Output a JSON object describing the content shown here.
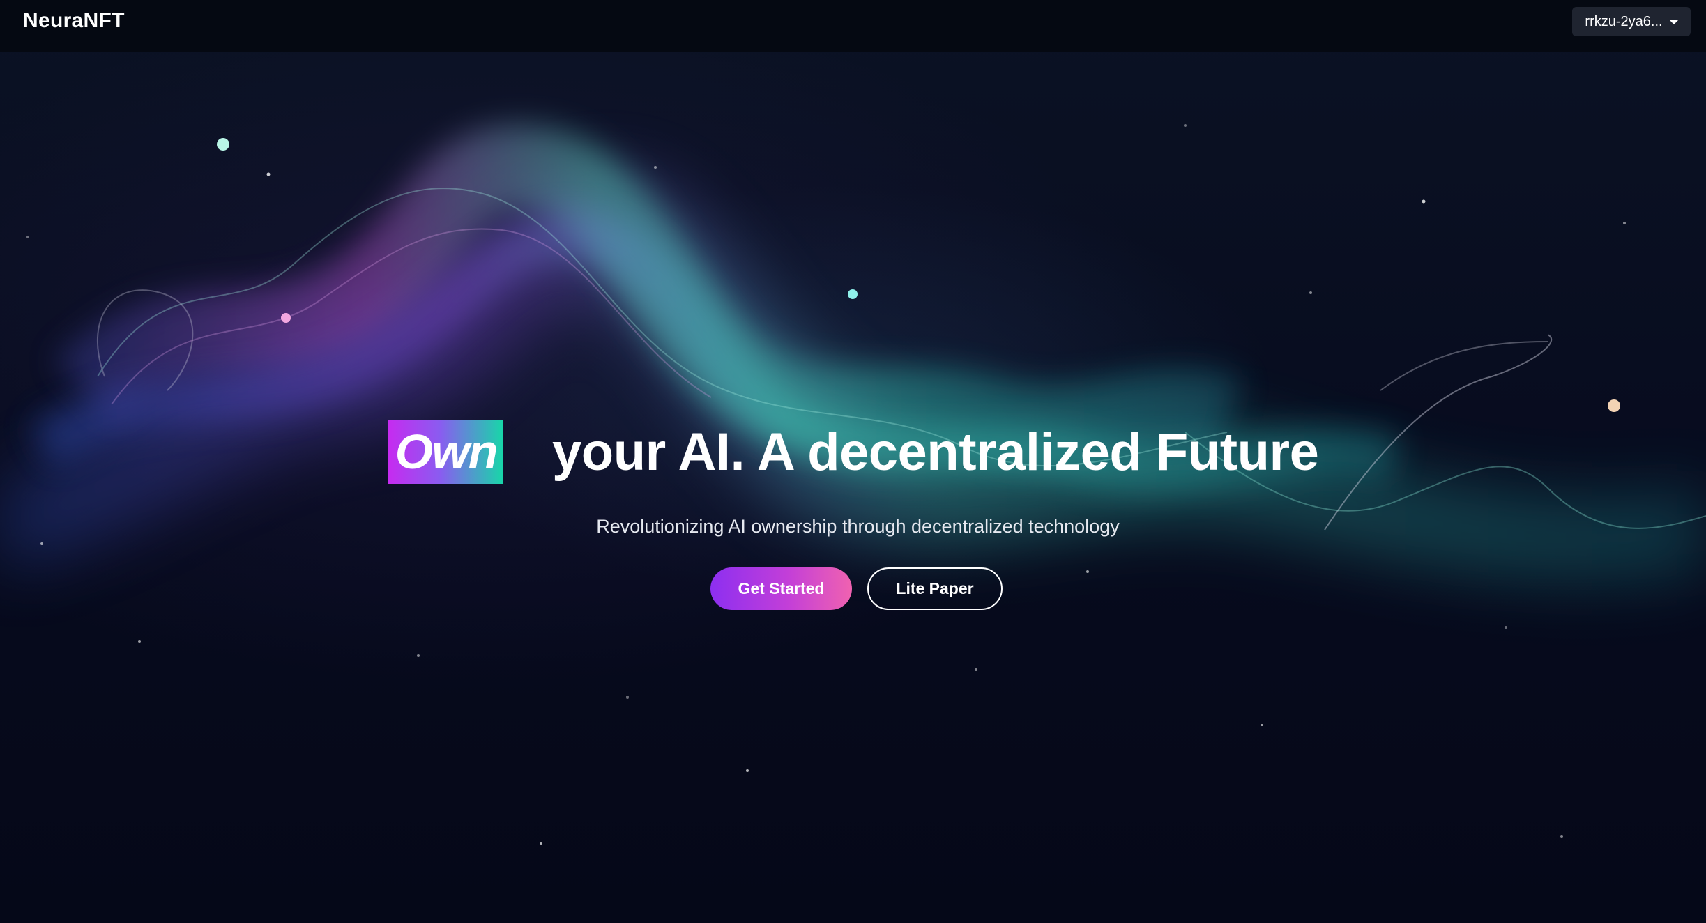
{
  "navbar": {
    "brand": "NeuraNFT",
    "wallet_label": "rrkzu-2ya6..."
  },
  "hero": {
    "highlight_word": "Own",
    "title_rest": "your AI. A decentralized Future",
    "subtitle": "Revolutionizing AI ownership through decentralized technology",
    "primary_button": "Get Started",
    "secondary_button": "Lite Paper"
  },
  "colors": {
    "background": "#070b1c",
    "highlight_gradient_start": "#c62bf0",
    "highlight_gradient_end": "#17d7a8",
    "primary_button_start": "#8d2ff0",
    "primary_button_end": "#f062b0"
  }
}
